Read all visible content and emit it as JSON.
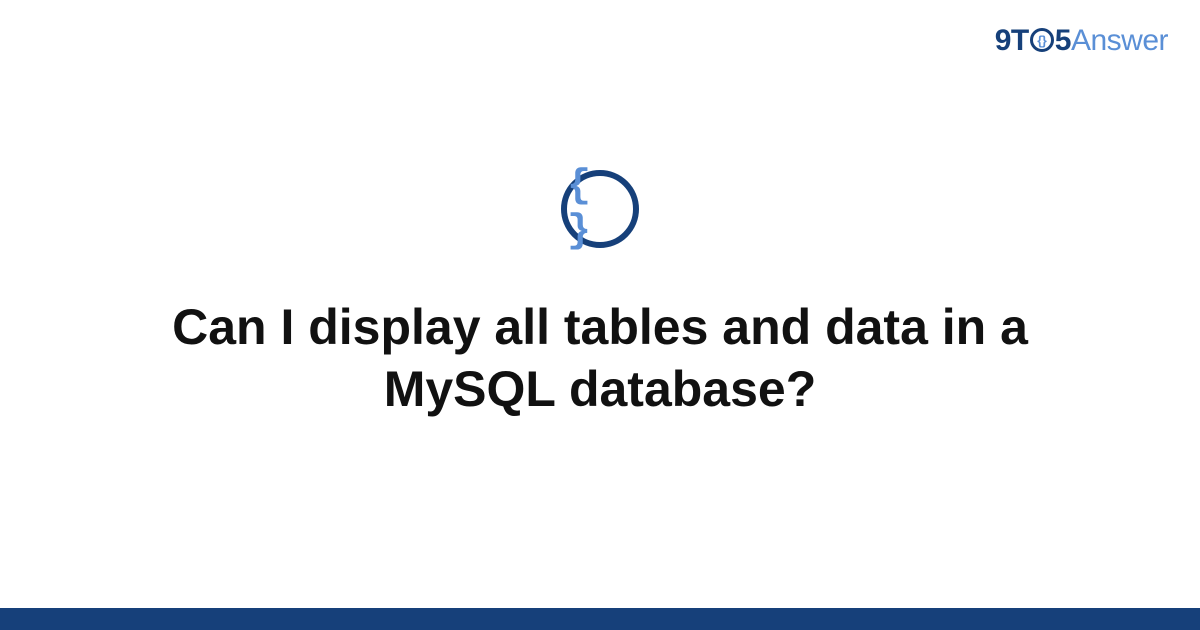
{
  "brand": {
    "prefix": "9T",
    "circle_glyph": "{}",
    "mid": "5",
    "suffix": "Answer"
  },
  "icon": {
    "glyph": "{ }"
  },
  "question": {
    "title": "Can I display all tables and data in a MySQL database?"
  },
  "colors": {
    "primary_dark": "#16407a",
    "primary_light": "#5a8fd6",
    "text": "#111111"
  }
}
